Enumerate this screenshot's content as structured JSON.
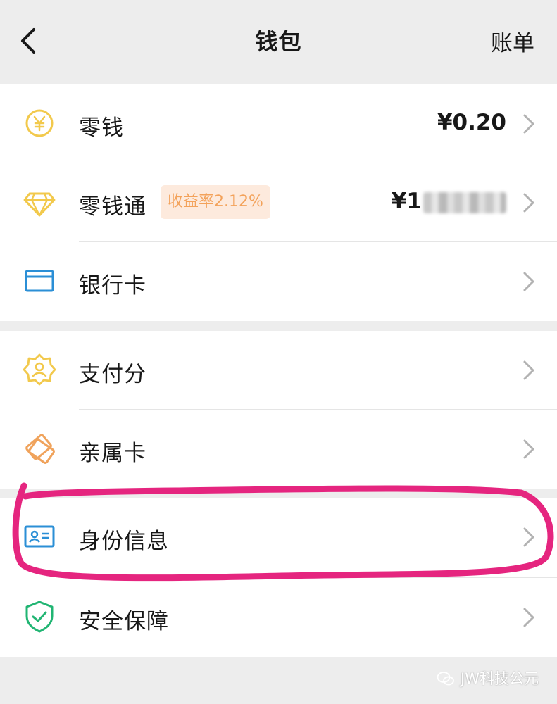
{
  "nav": {
    "title": "钱包",
    "right_action": "账单"
  },
  "section1": [
    {
      "id": "change",
      "label": "零钱",
      "value": "¥0.20",
      "icon": "yuan-circle-icon"
    },
    {
      "id": "licaitong",
      "label": "零钱通",
      "badge": "收益率2.12%",
      "value_prefix": "¥1",
      "icon": "diamond-icon"
    },
    {
      "id": "bankcard",
      "label": "银行卡",
      "icon": "bank-card-icon"
    }
  ],
  "section2": [
    {
      "id": "paymentscore",
      "label": "支付分",
      "icon": "payment-score-icon"
    },
    {
      "id": "familycard",
      "label": "亲属卡",
      "icon": "family-card-icon"
    },
    {
      "id": "identity",
      "label": "身份信息",
      "icon": "id-card-icon"
    },
    {
      "id": "security",
      "label": "安全保障",
      "icon": "shield-check-icon"
    }
  ],
  "watermark": {
    "text": "JW科技公元",
    "icon": "wechat-icon"
  },
  "colors": {
    "background": "#ededed",
    "yellow": "#f2c94c",
    "blue": "#2b8fd6",
    "orange": "#f0a35c",
    "green": "#21b573",
    "badge_bg": "#fdeadd",
    "badge_text": "#f3a25a",
    "annotation": "#e5257f"
  }
}
